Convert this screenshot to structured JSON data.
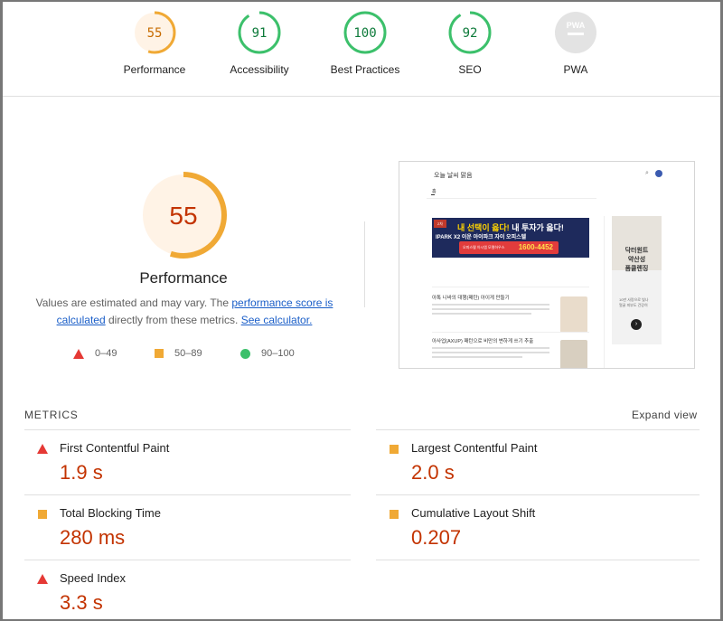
{
  "gauges": [
    {
      "label": "Performance",
      "score": "55",
      "color": "#f0a935",
      "bg": "#fff3e6",
      "fraction": 0.55
    },
    {
      "label": "Accessibility",
      "score": "91",
      "color": "#3cc06b",
      "bg": "#ffffff",
      "fraction": 0.91
    },
    {
      "label": "Best Practices",
      "score": "100",
      "color": "#3cc06b",
      "bg": "#ffffff",
      "fraction": 1.0
    },
    {
      "label": "SEO",
      "score": "92",
      "color": "#3cc06b",
      "bg": "#ffffff",
      "fraction": 0.92
    },
    {
      "label": "PWA",
      "score": "PWA",
      "color": "#9e9e9e",
      "bg": "#e3e3e3",
      "fraction": 0
    }
  ],
  "main": {
    "score": "55",
    "fraction": 0.55,
    "title": "Performance",
    "estimate_text": "Values are estimated and may vary. The ",
    "estimate_link": "performance score is calculated",
    "estimate_mid": " directly from these metrics. ",
    "calc_link": "See calculator.",
    "legend": {
      "fail": "0–49",
      "average": "50–89",
      "pass": "90–100"
    }
  },
  "thumbnail": {
    "site_title": "오늘 날씨 맑음",
    "tab": "홈",
    "banner_line1_a": "내 선택이 옳다! ",
    "banner_line1_b": "내 투자가 옳다!",
    "banner_brand": "IPARK X2 이운 아이파크 자이 오피스텔",
    "banner_phone": "1600-4452",
    "banner_phone_note": "오피스텔 아시엠 모델하우스",
    "article1_title": "아톡 니바의 대행(패턴) 아이게 만들기",
    "article2_title": "아사업(AXUP) 패턴으로 비만의 변하게 쓰기 추출",
    "side_ad": "닥터원트\n약산성\n폼클렌징",
    "side_ad_small": "10만 사랑으로 빛나\n얼굴 피부도 건강히"
  },
  "metrics": {
    "label": "METRICS",
    "expand": "Expand view",
    "items": [
      {
        "title": "First Contentful Paint",
        "value": "1.9 s",
        "status": "fail"
      },
      {
        "title": "Largest Contentful Paint",
        "value": "2.0 s",
        "status": "average"
      },
      {
        "title": "Total Blocking Time",
        "value": "280 ms",
        "status": "average"
      },
      {
        "title": "Cumulative Layout Shift",
        "value": "0.207",
        "status": "average"
      },
      {
        "title": "Speed Index",
        "value": "3.3 s",
        "status": "fail"
      }
    ]
  },
  "colors": {
    "fail": "#e53935",
    "average": "#f0a935",
    "pass": "#3cc06b",
    "value_red": "#c33300",
    "link": "#1a5ec8"
  }
}
